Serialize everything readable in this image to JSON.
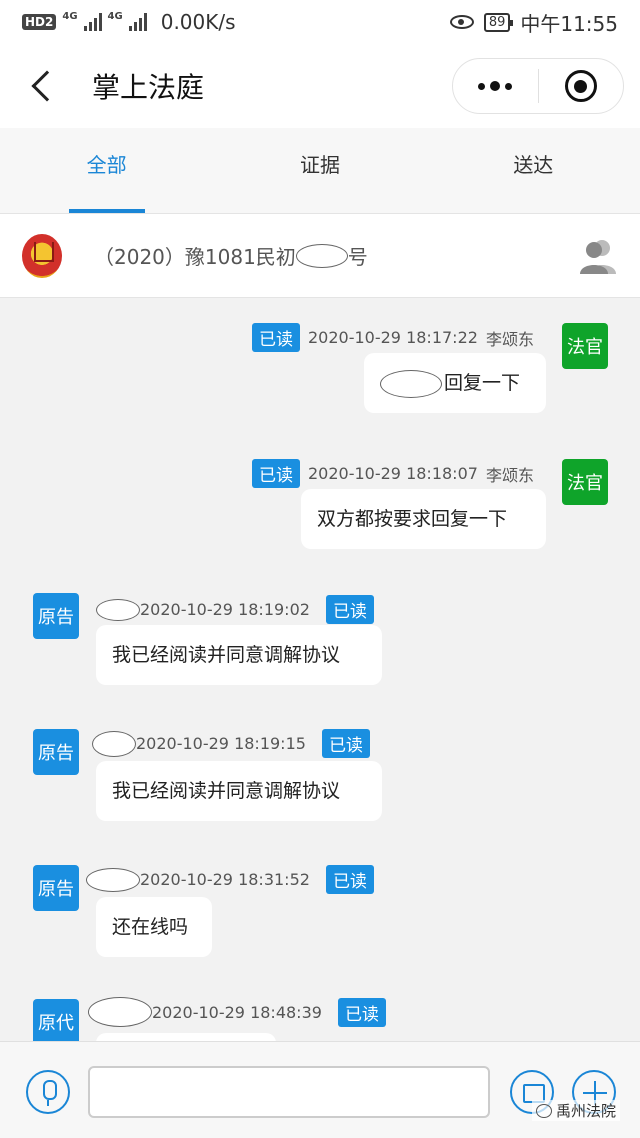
{
  "status_bar": {
    "hd": "HD",
    "hd_sub": "2",
    "net1": "4G",
    "net2": "4G",
    "speed": "0.00K/s",
    "battery": "89",
    "time": "中午11:55"
  },
  "nav": {
    "title": "掌上法庭"
  },
  "tabs": [
    {
      "label": "全部",
      "active": true
    },
    {
      "label": "证据",
      "active": false
    },
    {
      "label": "送达",
      "active": false
    }
  ],
  "case": {
    "number_prefix": "（2020）豫1081民初",
    "number_suffix": "号"
  },
  "messages": [
    {
      "side": "right",
      "role": "法官",
      "read": "已读",
      "time": "2020-10-29 18:17:22",
      "name": "李颂东",
      "text": "回复一下"
    },
    {
      "side": "right",
      "role": "法官",
      "read": "已读",
      "time": "2020-10-29 18:18:07",
      "name": "李颂东",
      "text": "双方都按要求回复一下"
    },
    {
      "side": "left",
      "role": "原告",
      "read": "已读",
      "time": "2020-10-29 18:19:02",
      "text": "我已经阅读并同意调解协议"
    },
    {
      "side": "left",
      "role": "原告",
      "read": "已读",
      "time": "2020-10-29 18:19:15",
      "text": "我已经阅读并同意调解协议"
    },
    {
      "side": "left",
      "role": "原告",
      "read": "已读",
      "time": "2020-10-29 18:31:52",
      "text": "还在线吗"
    },
    {
      "side": "left",
      "role": "原代",
      "read": "已读",
      "time": "2020-10-29 18:48:39",
      "text": ""
    }
  ],
  "footer": {
    "watermark": "禹州法院"
  },
  "icons": {
    "back": "back-arrow-icon",
    "more": "more-dots-icon",
    "close_app": "target-icon",
    "emblem": "court-emblem-icon",
    "participants": "participants-icon",
    "voice": "microphone-icon",
    "image": "image-icon",
    "add": "plus-icon"
  },
  "colors": {
    "accent": "#1a86d6",
    "judge": "#0fa42a",
    "party": "#1a8fe0"
  }
}
